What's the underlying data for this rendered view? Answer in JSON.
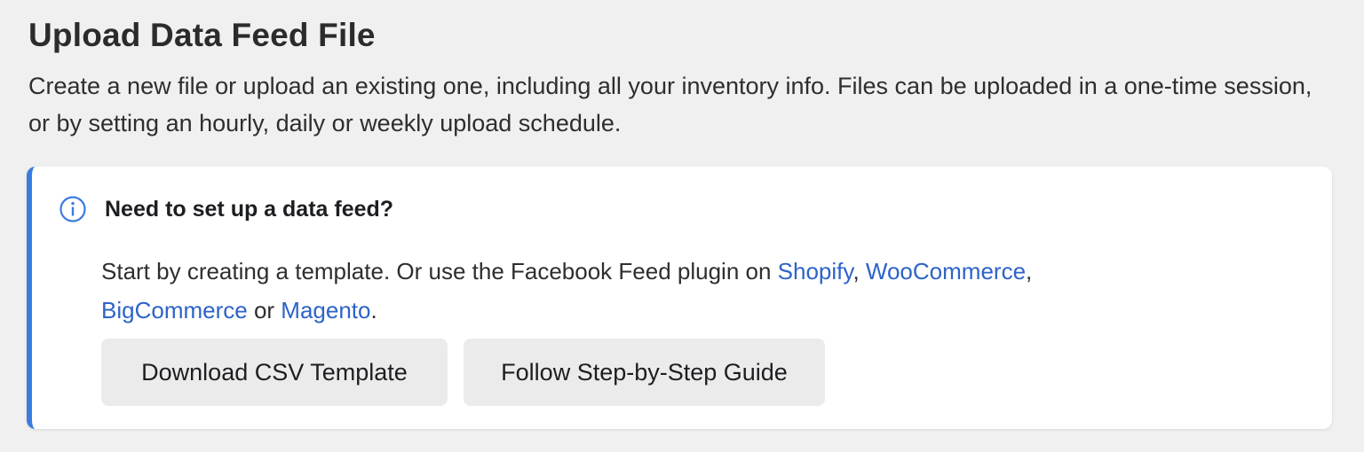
{
  "page": {
    "title": "Upload Data Feed File",
    "description": "Create a new file or upload an existing one, including all your inventory info. Files can be uploaded in a one-time session, or by setting an hourly, daily or weekly upload schedule."
  },
  "info_card": {
    "icon": "info-icon",
    "accent_color": "#3b7be0",
    "title": "Need to set up a data feed?",
    "body": {
      "text_start": "Start by creating a template. Or use the Facebook Feed plugin on ",
      "links": {
        "shopify": "Shopify",
        "woocommerce": "WooCommerce",
        "bigcommerce": "BigCommerce",
        "magento": "Magento"
      },
      "sep_comma_1": ", ",
      "sep_comma_2": ",",
      "sep_or": " or ",
      "end": "."
    },
    "buttons": {
      "download_csv": "Download CSV Template",
      "step_guide": "Follow Step-by-Step Guide"
    }
  }
}
